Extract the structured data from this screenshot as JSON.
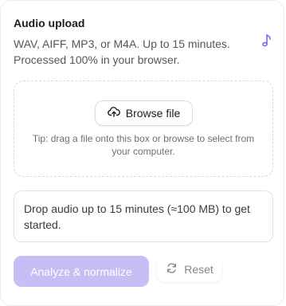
{
  "header": {
    "title": "Audio upload",
    "description": "WAV, AIFF, MP3, or M4A. Up to 15 minutes. Processed 100% in your browser."
  },
  "icons": {
    "note": "music-note-icon",
    "upload": "upload-cloud-icon",
    "reset": "refresh-icon"
  },
  "colors": {
    "accent": "#7c5cf0",
    "analyze_disabled_bg": "#c9bdf6"
  },
  "dropzone": {
    "browse_label": "Browse file",
    "tip": "Tip: drag a file onto this box or browse to select from your computer."
  },
  "status": {
    "message": "Drop audio up to 15 minutes (≈100 MB) to get started."
  },
  "actions": {
    "analyze_label": "Analyze & normalize",
    "reset_label": "Reset"
  }
}
